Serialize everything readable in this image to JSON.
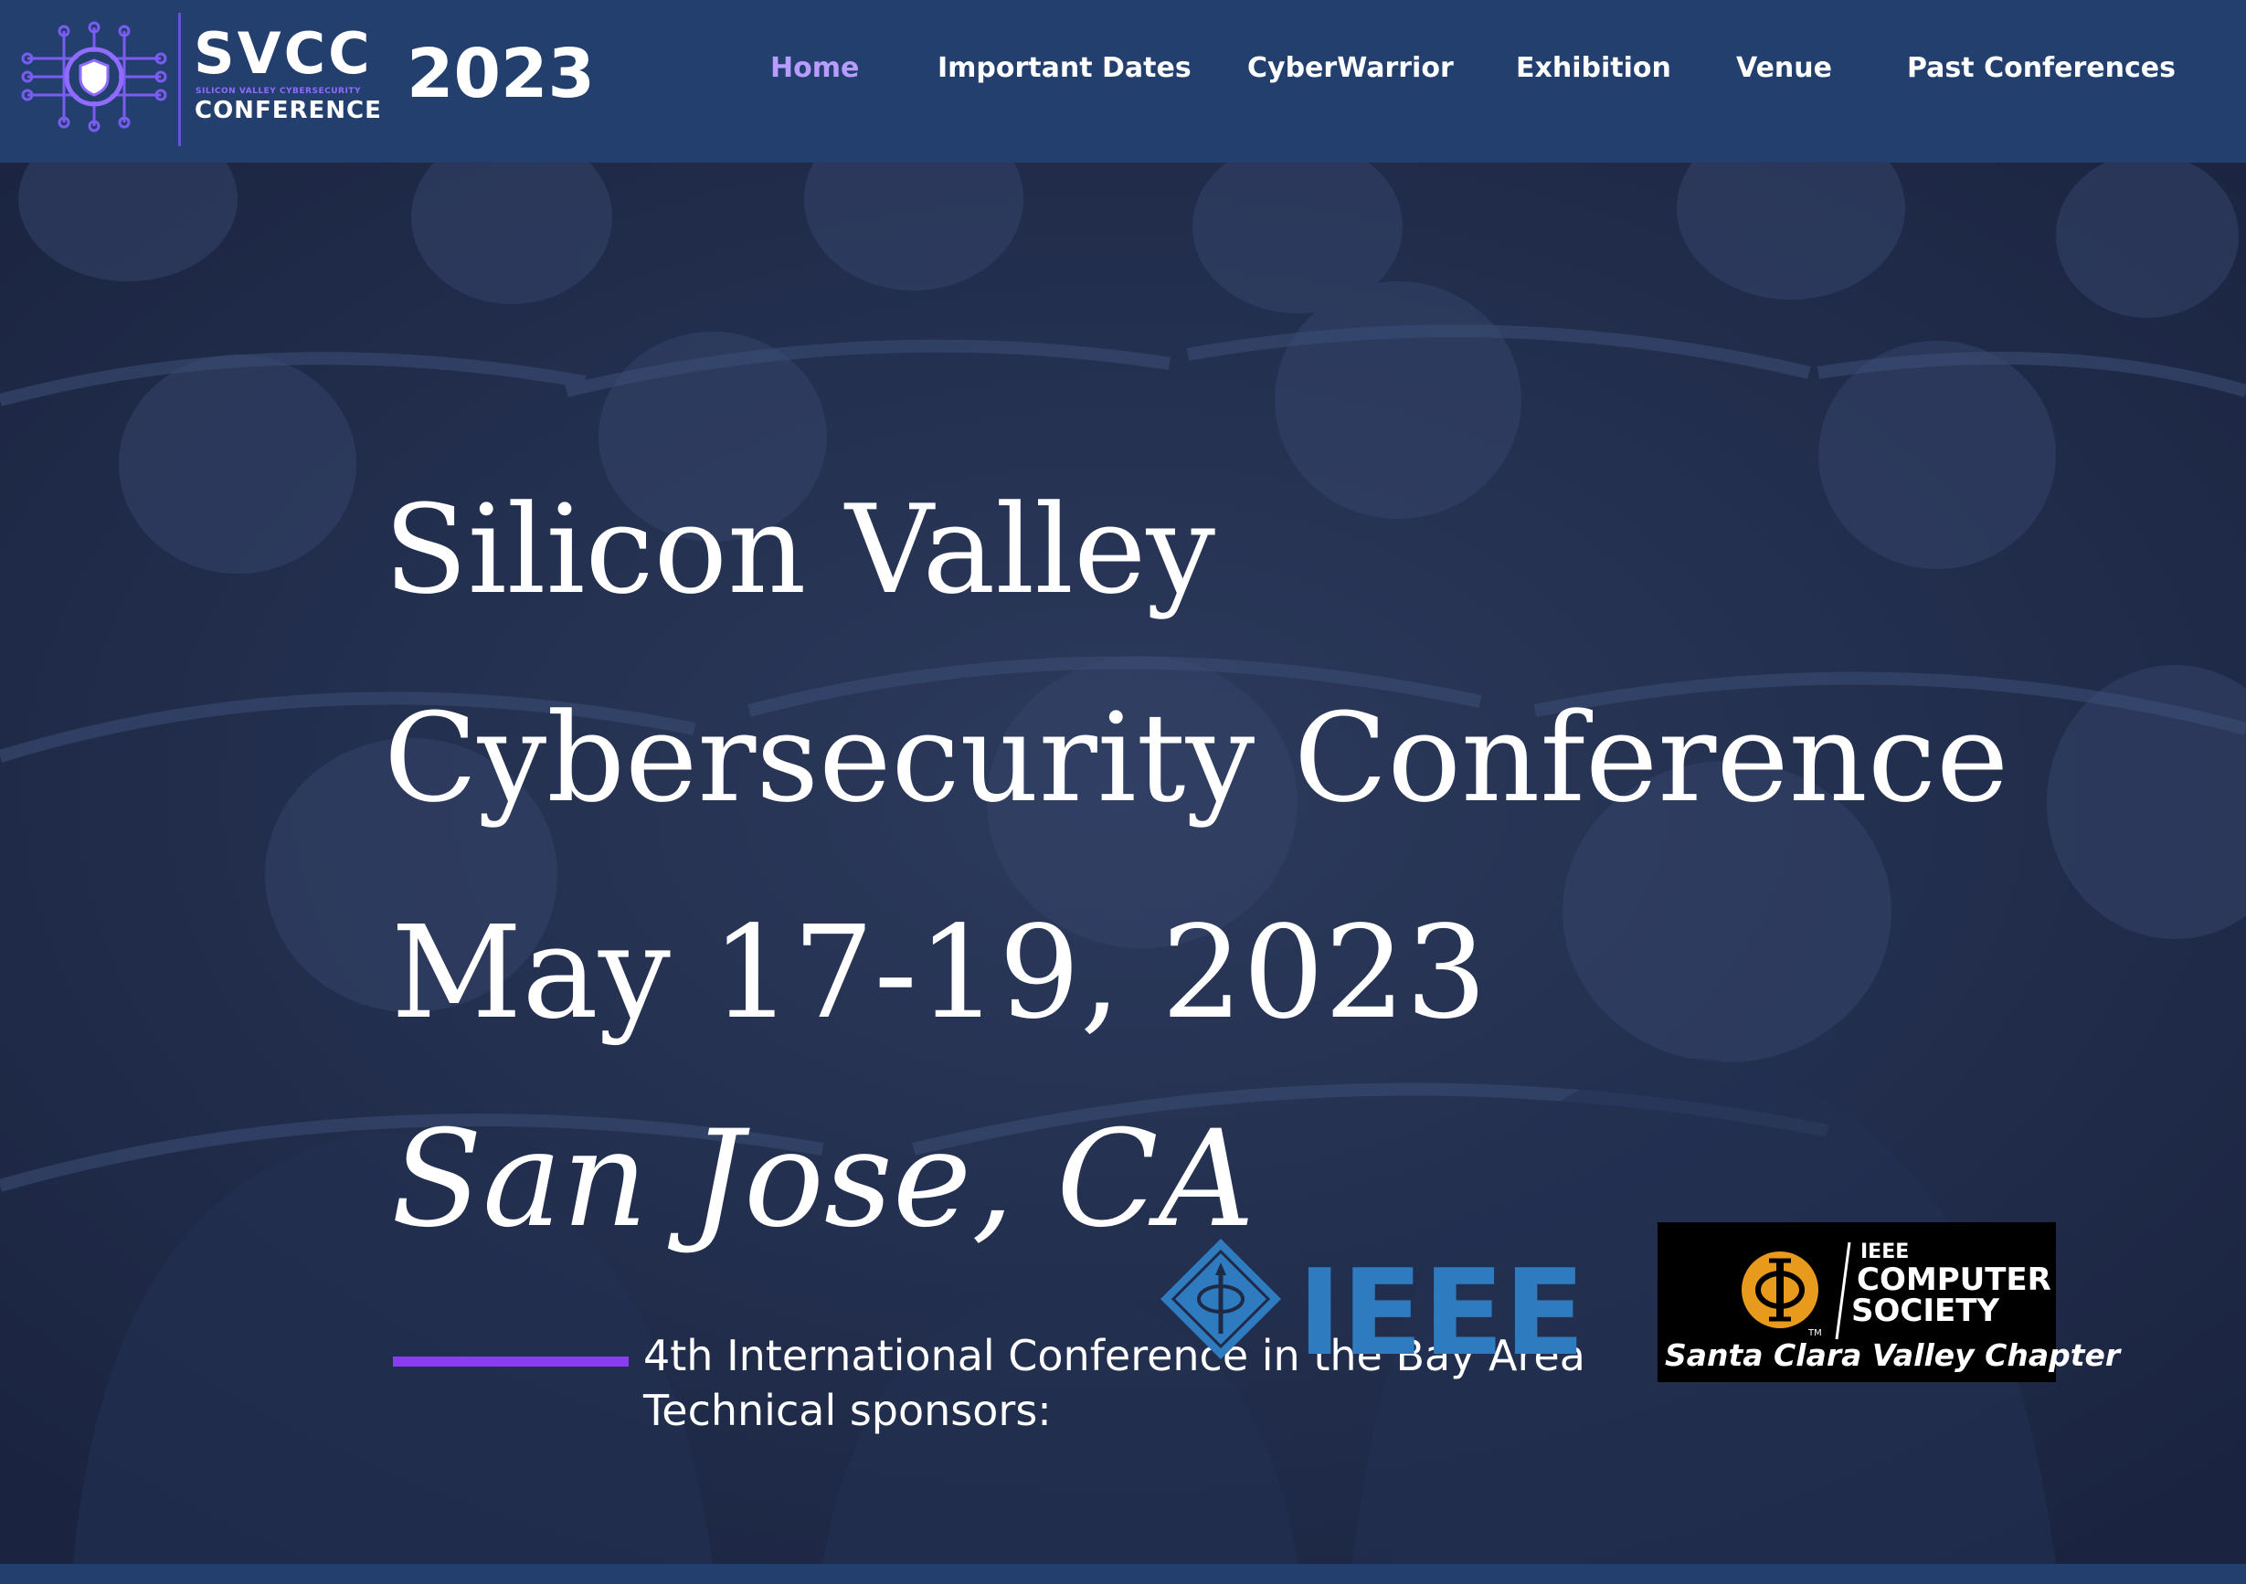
{
  "logo": {
    "wordmark": "SVCC",
    "tagline": "SILICON VALLEY CYBERSECURITY",
    "subword": "CONFERENCE"
  },
  "header": {
    "year": "2023"
  },
  "nav": {
    "items": [
      {
        "label": "Home",
        "active": true
      },
      {
        "label": "Important Dates",
        "active": false
      },
      {
        "label": "CyberWarrior",
        "active": false
      },
      {
        "label": "Exhibition",
        "active": false
      },
      {
        "label": "Venue",
        "active": false
      },
      {
        "label": "Past Conferences",
        "active": false
      }
    ]
  },
  "hero": {
    "title_line1": "Silicon Valley",
    "title_line2": "Cybersecurity Conference",
    "date": "May 17-19, 2023",
    "location": "San Jose, CA",
    "subtitle": "4th International Conference in the Bay Area",
    "sponsors_label": "Technical sponsors:"
  },
  "sponsors": {
    "ieee_wordmark": "IEEE",
    "computer_society": {
      "small": "IEEE",
      "line1": "COMPUTER",
      "line2": "SOCIETY",
      "chapter": "Santa Clara Valley Chapter"
    }
  },
  "colors": {
    "header_bg": "#223f6e",
    "hero_bg": "#1f2a46",
    "nav_active": "#b89cff",
    "accent": "#8a3cf0",
    "ieee_blue": "#2f7bbf",
    "cs_gold": "#e89a1c"
  },
  "icons": [
    "circuit-shield-logo-icon",
    "ieee-diamond-icon",
    "computer-society-phi-icon"
  ]
}
